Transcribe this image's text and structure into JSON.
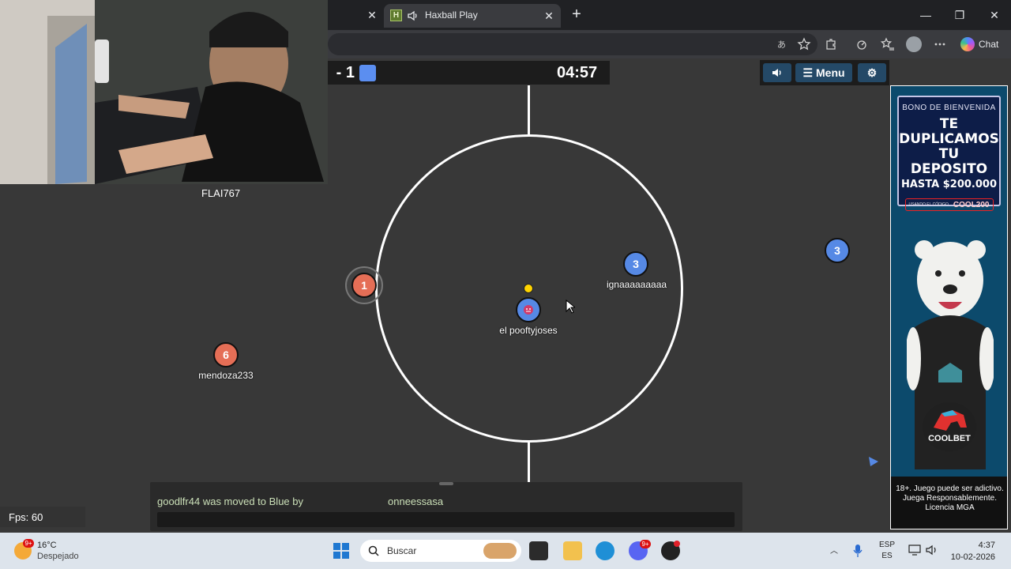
{
  "browser": {
    "tab_title": "Haxball Play",
    "chat_button_label": "Chat"
  },
  "game": {
    "score_visible": "- 1",
    "timer": "04:57",
    "menu_label": "Menu",
    "colors": {
      "red_team": "#e56e56",
      "blue_team": "#5689e5",
      "ball": "#ffd400",
      "field": "#383838"
    },
    "players": [
      {
        "number": "1",
        "team": "red",
        "name": ""
      },
      {
        "number": "6",
        "team": "red",
        "name": "mendoza233"
      },
      {
        "number": "3",
        "team": "blue",
        "name": "ignaaaaaaaaa"
      },
      {
        "number": "",
        "team": "blue",
        "name": "el pooftyjoses"
      },
      {
        "number": "3",
        "team": "blue",
        "name": ""
      }
    ],
    "chat": {
      "message": "goodlfr44 was moved to Blue by",
      "message_name": "onneessasa"
    },
    "fps": "Fps: 60"
  },
  "webcam": {
    "streamer_name": "FLAI767"
  },
  "ad": {
    "bono": "BONO DE BIENVENIDA",
    "headline_line1": "TE DUPLICAMOS",
    "headline_line2": "TU DEPOSITO",
    "headline_line3": "HASTA $200.000",
    "code_prefix": "USANDO EL CÓDIGO",
    "code": "COOL200",
    "brand": "COOLBET",
    "disclaimer": "18+. Juego puede ser adictivo. Juega Responsablemente. Licencia MGA"
  },
  "taskbar": {
    "weather_badge": "9+",
    "temperature": "16°C",
    "condition": "Despejado",
    "search_placeholder": "Buscar",
    "discord_badge": "9+",
    "lang_top": "ESP",
    "lang_bottom": "ES",
    "time": "4:37",
    "date": "10-02-2026"
  }
}
